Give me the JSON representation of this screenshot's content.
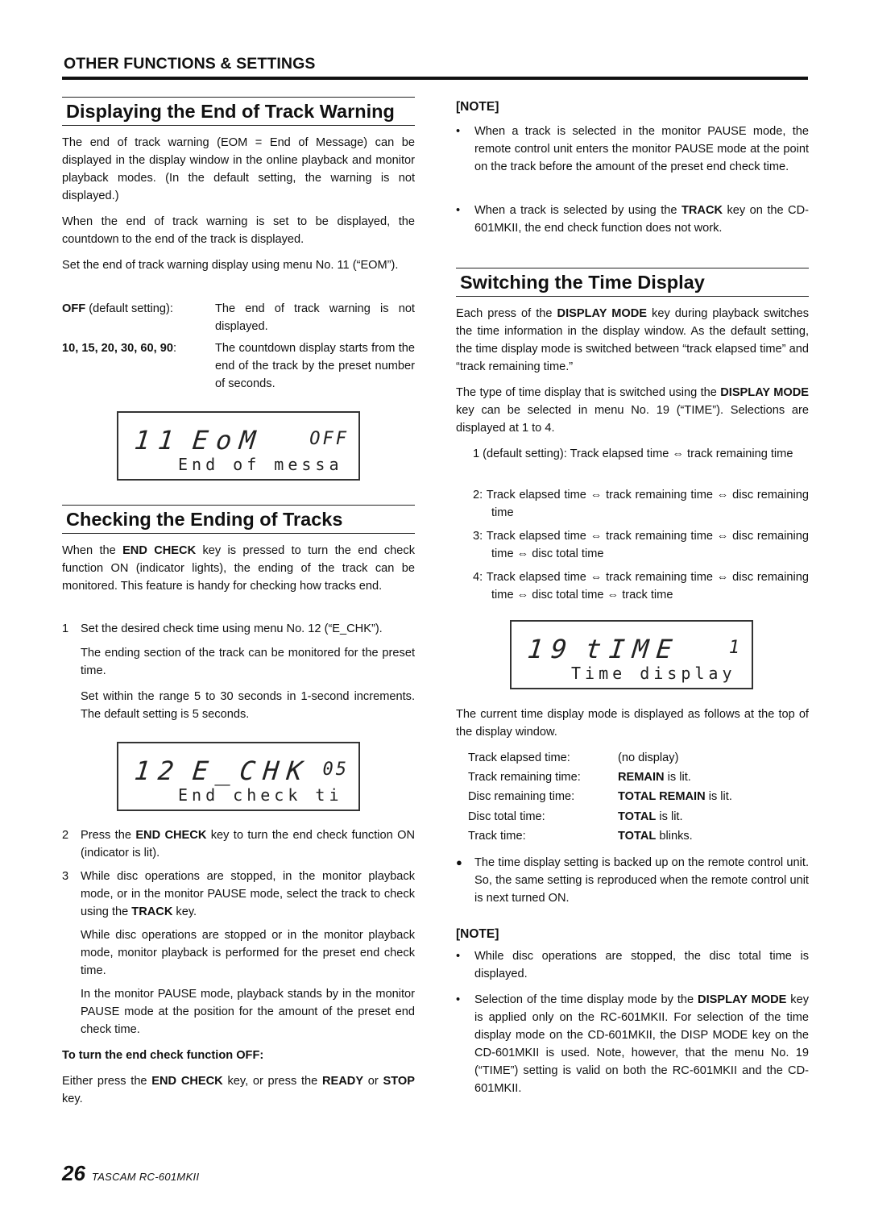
{
  "section_header": "OTHER FUNCTIONS & SETTINGS",
  "eom_section": {
    "title": "Displaying the End of Track Warning",
    "para1": "The end of track warning (EOM = End of Message) can be displayed in the display window in the online playback and monitor playback modes. (In the default setting, the warning is not displayed.)",
    "para2": "When the end of track warning is set to be displayed, the countdown to the end of the track is displayed.",
    "para3": "Set the end of track warning display using menu No. 11 (“EOM”).",
    "options": [
      {
        "key_bold": "OFF",
        "key_rest": " (default setting):",
        "value": "The end of track warning is not displayed."
      },
      {
        "key_bold": "10, 15, 20, 30, 60, 90",
        "key_rest": ":",
        "value": "The countdown display starts from the end of the track by the preset number of seconds."
      }
    ],
    "lcd": {
      "menu_number": "11",
      "menu_code": "EoM",
      "value": "OFF",
      "caption": "End of messa"
    }
  },
  "end_check_section": {
    "title": "Checking the Ending of Tracks",
    "intro": {
      "pre": "When the ",
      "bold": "END CHECK",
      "post": " key is pressed to turn the end check function ON (indicator lights), the ending of the track can be monitored. This feature is handy for checking how tracks end."
    },
    "step1": {
      "num": "1",
      "text": "Set the desired check time using menu No. 12 (“E_CHK”).",
      "sub1": "The ending section of the track can be monitored for the preset time.",
      "sub2": "Set within the range 5 to 30 seconds in 1-second increments. The default setting is 5 seconds."
    },
    "lcd": {
      "menu_number": "12",
      "menu_code": "E_CHK",
      "value": "05",
      "caption": "End check ti"
    },
    "step2": {
      "num": "2",
      "pre": "Press the ",
      "bold": "END CHECK",
      "post": " key to turn the end check function ON (indicator is lit)."
    },
    "step3": {
      "num": "3",
      "pre": "While disc operations are stopped, in the monitor playback mode, or in the monitor PAUSE mode, select the track to check using the ",
      "bold": "TRACK",
      "post": " key.",
      "sub1": "While disc operations are stopped or in the monitor playback mode, monitor playback is performed for the preset end check time.",
      "sub2": "In the monitor PAUSE mode, playback stands by in the monitor PAUSE mode at the position for the amount of the preset end check time."
    },
    "off_heading": "To turn the end check function OFF:",
    "off_text": {
      "p1": "Either press the ",
      "b1": "END CHECK",
      "p2": " key, or press the ",
      "b2": "READY",
      "p3": " or ",
      "b3": "STOP",
      "p4": " key."
    }
  },
  "note1": {
    "title": "[NOTE]",
    "bullets": [
      {
        "pre": "When a track is selected in the monitor PAUSE mode, the remote control unit enters the monitor PAUSE mode at the point on the track before the amount of the preset end check time.",
        "bold": "",
        "post": ""
      },
      {
        "pre": "When a track is selected by using the ",
        "bold": "TRACK",
        "post": " key on the CD-601MKII, the end check function does not work."
      }
    ]
  },
  "time_section": {
    "title": "Switching the Time Display",
    "para1": {
      "pre": "Each press of the ",
      "bold": "DISPLAY MODE",
      "post": " key during playback switches the time information in the display window. As the default setting, the time display mode is switched between “track elapsed time” and “track remaining time.”"
    },
    "para2": {
      "pre": "The type of time display that is switched using the ",
      "bold": "DISPLAY MODE",
      "post": " key can be selected in menu No. 19 (“TIME”). Selections are displayed at 1 to 4."
    },
    "options": [
      "1 (default setting): Track elapsed time ⇔ track remaining time",
      "2: Track elapsed time ⇔ track remaining time ⇔ disc remaining time",
      "3: Track elapsed time ⇔ track remaining time ⇔ disc remaining time ⇔ disc total time",
      "4: Track elapsed time ⇔ track remaining time ⇔ disc remaining time ⇔ disc total time ⇔ track time"
    ],
    "lcd": {
      "menu_number": "19",
      "menu_code": "tIME",
      "value": "1",
      "caption": "Time display"
    },
    "para3": "The current time display mode is displayed as follows at the top of the display window.",
    "modes": [
      {
        "label": "Track elapsed time:",
        "bold": "",
        "rest": "(no display)"
      },
      {
        "label": "Track remaining time:",
        "bold": "REMAIN",
        "rest": " is lit."
      },
      {
        "label": "Disc remaining time:",
        "bold": "TOTAL REMAIN",
        "rest": " is lit."
      },
      {
        "label": "Disc total time:",
        "bold": "TOTAL",
        "rest": " is lit."
      },
      {
        "label": "Track time:",
        "bold": "TOTAL",
        "rest": " blinks."
      }
    ],
    "backup_note": "The time display setting is backed up on the remote control unit. So, the same setting is reproduced when the remote control unit is next turned ON."
  },
  "note2": {
    "title": "[NOTE]",
    "bullets": [
      {
        "pre": "While disc operations are stopped, the disc total time is displayed.",
        "bold": "",
        "post": ""
      },
      {
        "pre": "Selection of the time display mode by the ",
        "bold": "DISPLAY MODE",
        "post": " key is applied only on the RC-601MKII. For selection of the time display mode on the CD-601MKII, the DISP MODE key on the CD-601MKII is used. Note, however, that the menu No. 19 (“TIME”) setting is valid on both the RC-601MKII and the CD-601MKII."
      }
    ]
  },
  "footer": {
    "page_number": "26",
    "model": "TASCAM  RC-601MKII"
  },
  "bullet_marks": {
    "small": "•",
    "large": "●"
  }
}
